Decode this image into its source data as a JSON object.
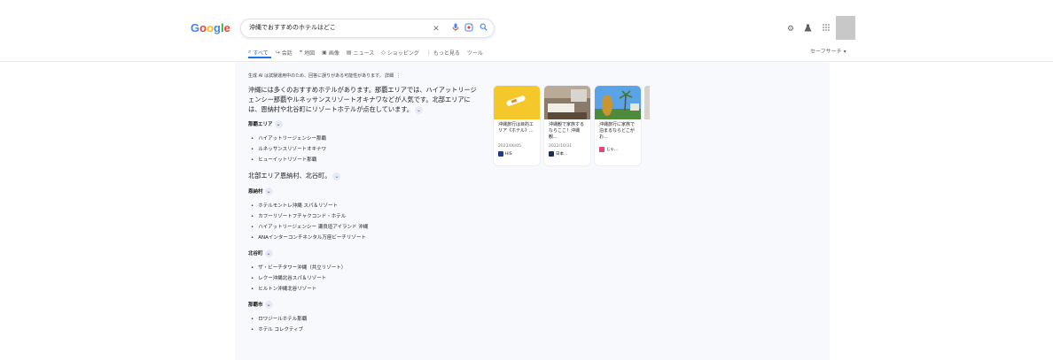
{
  "logo": {
    "text": "Google",
    "letters": [
      "G",
      "o",
      "o",
      "g",
      "l",
      "e"
    ]
  },
  "search": {
    "query": "沖縄でおすすめのホテルはどこ",
    "clear_icon": "close-icon",
    "mic_icon": "mic-icon",
    "lens_icon": "lens-icon",
    "search_icon": "search-icon"
  },
  "header_icons": [
    "gear-icon",
    "labs-flask-icon",
    "apps-grid-icon"
  ],
  "tabs": [
    {
      "label": "すべて",
      "icon": "search-icon",
      "active": true
    },
    {
      "label": "会話",
      "icon": "reply-icon"
    },
    {
      "label": "地図",
      "icon": "map-pin-icon"
    },
    {
      "label": "画像",
      "icon": "image-icon"
    },
    {
      "label": "ニュース",
      "icon": "news-icon"
    },
    {
      "label": "ショッピング",
      "icon": "tag-icon"
    },
    {
      "label": "もっと見る",
      "icon": "more-vert-icon"
    },
    {
      "label": "ツール"
    }
  ],
  "safesearch": {
    "label": "セーフサーチ",
    "icon": "caret-down-icon"
  },
  "ai_overview": {
    "notice": "生成 AI は試験運用中のため、回答に誤りがある可能性があります。 詳細",
    "summary": "沖縄には多くのおすすめホテルがあります。那覇エリアでは、ハイアットリージェンシー那覇やルネッサンスリゾートオキナワなどが人気です。北部エリアには、恩納村や北谷町にリゾートホテルが点在しています。",
    "sections": {
      "naha": {
        "title": "那覇エリア",
        "items": [
          "ハイアットリージェンシー那覇",
          "ルネッサンスリゾートオキナワ",
          "ヒューイットリゾート那覇"
        ]
      },
      "north": {
        "title": "北部エリア恩納村、北谷町。"
      },
      "onna": {
        "title": "恩納村",
        "items": [
          "ホテルモントレ沖縄 スパ＆リゾート",
          "カフーリゾートフチャクコンド・ホテル",
          "ハイアットリージェンシー 瀬良垣アイランド 沖縄",
          "ANAインターコンチネンタル万座ビーチリゾート"
        ]
      },
      "chatan": {
        "title": "北谷町",
        "items": [
          "ザ・ビーチタワー沖縄（共立リゾート）",
          "レクー沖縄北谷スパ＆リゾート",
          "ヒルトン沖縄北谷リゾート"
        ]
      },
      "nahashi": {
        "title": "那覇市",
        "items": [
          "ロワジールホテル那覇",
          "ホテル コレクティブ"
        ]
      }
    }
  },
  "cards": [
    {
      "title": "沖縄旅行は目的エリア《ホテル》...",
      "date": "2023/06/05",
      "source": "HIS",
      "favicon_color": "#1f3a93"
    },
    {
      "title": "沖縄観で家族するならここ！沖縄観...",
      "date": "2022/10/31",
      "source": "日本...",
      "favicon_color": "#1c2a5c"
    },
    {
      "title": "沖縄旅行に家族で泊まるならどこがお...",
      "date": "",
      "source": "じゃ...",
      "favicon_color": "#e0457b"
    }
  ]
}
